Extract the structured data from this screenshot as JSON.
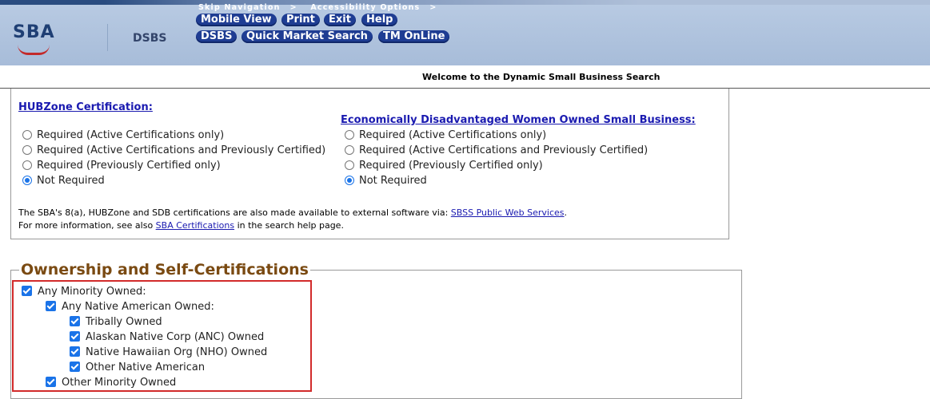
{
  "header": {
    "logo_text": "SBA",
    "app_label": "DSBS",
    "skip_nav": "Skip Navigation",
    "accessibility": "Accessibility Options",
    "nav_row1": [
      "Mobile View",
      "Print",
      "Exit",
      "Help"
    ],
    "nav_row2": [
      "DSBS",
      "Quick Market Search",
      "TM OnLine"
    ]
  },
  "welcome": "Welcome to the Dynamic Small Business Search",
  "certifications": {
    "hubzone": {
      "title": "HUBZone Certification:",
      "options": [
        "Required (Active Certifications only)",
        "Required (Active Certifications and Previously Certified)",
        "Required (Previously Certified only)",
        "Not Required"
      ],
      "selected": "Not Required"
    },
    "edwosb": {
      "title": "Economically Disadvantaged Women Owned Small Business:",
      "options": [
        "Required (Active Certifications only)",
        "Required (Active Certifications and Previously Certified)",
        "Required (Previously Certified only)",
        "Not Required"
      ],
      "selected": "Not Required"
    },
    "note1_prefix": "The SBA's 8(a), HUBZone and SDB certifications are also made available to external software via: ",
    "note1_link": "SBSS Public Web Services",
    "note1_suffix": ".",
    "note2_prefix": "For more information, see also ",
    "note2_link": "SBA Certifications",
    "note2_suffix": " in the search help page."
  },
  "ownership": {
    "legend": "Ownership and Self-Certifications",
    "items": [
      {
        "label": "Any Minority Owned:",
        "checked": true
      },
      {
        "label": "Any Native American Owned:",
        "checked": true
      },
      {
        "label": "Tribally Owned",
        "checked": true
      },
      {
        "label": "Alaskan Native Corp (ANC) Owned",
        "checked": true
      },
      {
        "label": "Native Hawaiian Org (NHO) Owned",
        "checked": true
      },
      {
        "label": "Other Native American",
        "checked": true
      },
      {
        "label": "Other Minority Owned",
        "checked": true
      }
    ]
  }
}
